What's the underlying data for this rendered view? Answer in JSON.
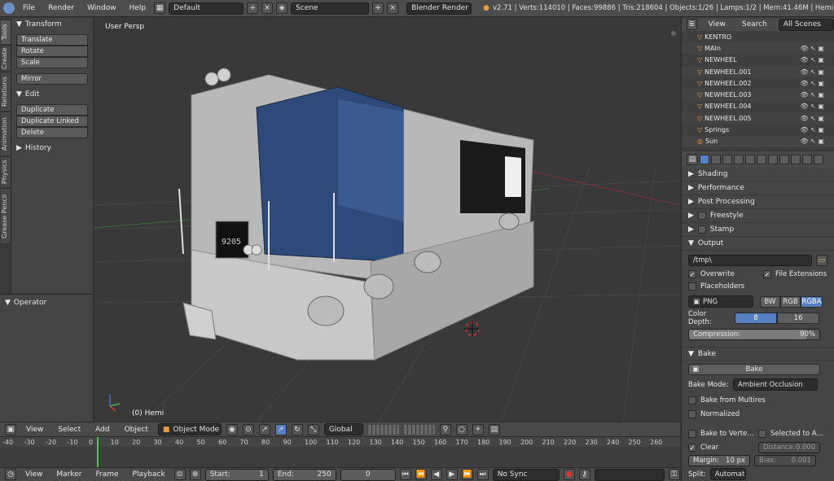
{
  "topbar": {
    "menus": [
      "File",
      "Render",
      "Window",
      "Help"
    ],
    "layout": "Default",
    "scene": "Scene",
    "engine": "Blender Render",
    "stats": "v2.71 | Verts:114010 | Faces:99886 | Tris:218604 | Objects:1/26 | Lamps:1/2 | Mem:41.46M | Hemi"
  },
  "tabs": [
    "Tools",
    "Create",
    "Relations",
    "Animation",
    "Physics",
    "Grease Pencil"
  ],
  "toolshelf": {
    "transform": {
      "title": "Transform",
      "buttons": [
        "Translate",
        "Rotate",
        "Scale"
      ],
      "mirror": "Mirror"
    },
    "edit": {
      "title": "Edit",
      "buttons": [
        "Duplicate",
        "Duplicate Linked",
        "Delete"
      ]
    },
    "history": "History"
  },
  "operator": {
    "title": "Operator"
  },
  "viewport": {
    "label": "User Persp",
    "object": "(0) Hemi",
    "plate": "9205"
  },
  "view_header": {
    "menus": [
      "View",
      "Select",
      "Add",
      "Object"
    ],
    "mode": "Object Mode",
    "orientation": "Global"
  },
  "timeline": {
    "ticks": [
      "-40",
      "-30",
      "-20",
      "-10",
      "0",
      "10",
      "20",
      "30",
      "40",
      "50",
      "60",
      "70",
      "80",
      "90",
      "100",
      "110",
      "120",
      "130",
      "140",
      "150",
      "160",
      "170",
      "180",
      "190",
      "200",
      "210",
      "220",
      "230",
      "240",
      "250",
      "260"
    ],
    "current_frame_value": 0
  },
  "timeline_header": {
    "menus": [
      "View",
      "Marker",
      "Frame",
      "Playback"
    ],
    "start_label": "Start:",
    "start": "1",
    "end_label": "End:",
    "end": "250",
    "frame": "0",
    "sync": "No Sync"
  },
  "outliner": {
    "menus": [
      "View",
      "Search"
    ],
    "scenes": "All Scenes",
    "items": [
      "KENTRO",
      "MAIn",
      "NEWHEEL",
      "NEWHEEL.001",
      "NEWHEEL.002",
      "NEWHEEL.003",
      "NEWHEEL.004",
      "NEWHEEL.005",
      "Springs",
      "Sun"
    ]
  },
  "props": {
    "sections_collapsed": [
      "Shading",
      "Performance",
      "Post Processing"
    ],
    "freestyle": "Freestyle",
    "stamp": "Stamp",
    "output": {
      "title": "Output",
      "path": "/tmp\\",
      "overwrite": "Overwrite",
      "file_ext": "File Extensions",
      "placeholders": "Placeholders",
      "format": "PNG",
      "bw": "BW",
      "rgb": "RGB",
      "rgba": "RGBA",
      "color_depth_label": "Color Depth:",
      "depth_8": "8",
      "depth_16": "16",
      "compression_label": "Compression:",
      "compression_value": "90%",
      "compression_fraction": 0.9
    },
    "bake": {
      "title": "Bake",
      "button": "Bake",
      "mode_label": "Bake Mode:",
      "mode": "Ambient Occlusion",
      "from_multires": "Bake from Multires",
      "normalized": "Normalized",
      "to_vertex": "Bake to Verte...",
      "selected_to_active": "Selected to A...",
      "clear": "Clear",
      "distance": "Distance:0.000",
      "margin": "Margin:",
      "margin_value": "10 px",
      "bias": "Bias:",
      "bias_value": "0.001",
      "split_label": "Split:",
      "split": "Automat"
    }
  },
  "colors": {
    "accent": "#5680c2",
    "bg": "#393939",
    "panel": "#454545",
    "train_blue": "#2e4a7a",
    "selected": "#f0a040"
  }
}
